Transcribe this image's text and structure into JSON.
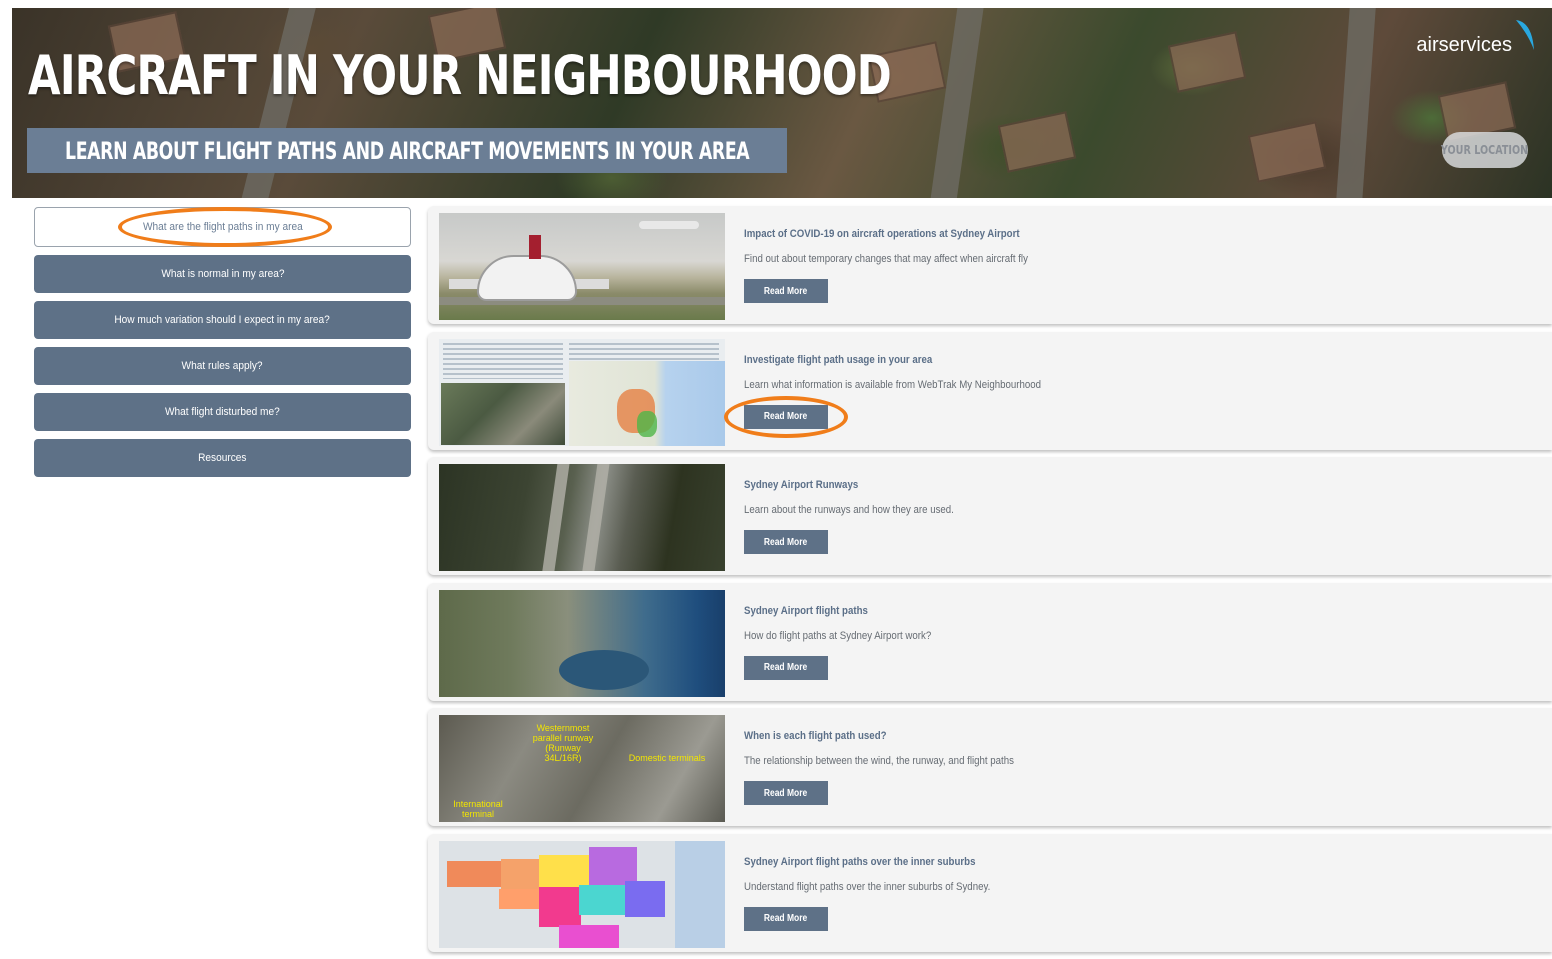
{
  "hero": {
    "title": "AIRCRAFT IN YOUR NEIGHBOURHOOD",
    "subtitle": "LEARN ABOUT FLIGHT PATHS AND AIRCRAFT MOVEMENTS IN YOUR AREA",
    "logo": "airservices",
    "location_button": "YOUR LOCATION"
  },
  "sidebar": {
    "items": [
      {
        "label": "What are the flight paths in my area",
        "active": true
      },
      {
        "label": "What is normal in my area?"
      },
      {
        "label": "How much variation should I expect in my area?"
      },
      {
        "label": "What rules apply?"
      },
      {
        "label": "What flight disturbed me?"
      },
      {
        "label": "Resources"
      }
    ]
  },
  "cards": [
    {
      "title": "Impact of COVID-19 on aircraft operations at Sydney Airport",
      "desc": "Find out about temporary changes that may affect when aircraft fly",
      "button": "Read More"
    },
    {
      "title": "Investigate flight path usage in your area",
      "desc": "Learn what information is available from WebTrak My Neighbourhood",
      "button": "Read More"
    },
    {
      "title": "Sydney Airport Runways",
      "desc": "Learn about the runways and how they are used.",
      "button": "Read More"
    },
    {
      "title": "Sydney Airport flight paths",
      "desc": "How do flight paths at Sydney Airport work?",
      "button": "Read More"
    },
    {
      "title": "When is each flight path used?",
      "desc": "The relationship between the wind, the runway, and flight paths",
      "button": "Read More"
    },
    {
      "title": "Sydney Airport flight paths over the inner suburbs",
      "desc": "Understand flight paths over the inner suburbs of Sydney.",
      "button": "Read More"
    }
  ],
  "thumb5_labels": {
    "runway": "Westernmost parallel runway (Runway 34L/16R)",
    "domestic": "Domestic terminals",
    "international": "International terminal"
  },
  "colors": {
    "accent": "#5e7187",
    "highlight": "#f07d1a"
  }
}
